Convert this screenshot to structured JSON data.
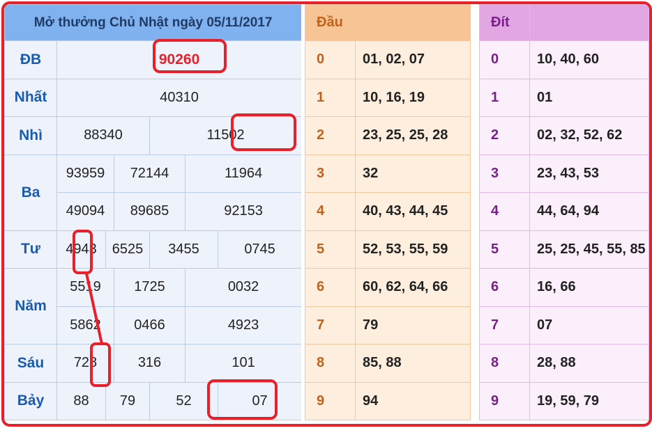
{
  "left_table": {
    "header": "Mở thưởng Chủ Nhật ngày 05/11/2017",
    "prizes": [
      {
        "label": "ĐB",
        "values": [
          "90260"
        ]
      },
      {
        "label": "Nhất",
        "values": [
          "40310"
        ]
      },
      {
        "label": "Nhì",
        "values": [
          "88340",
          "11502"
        ]
      },
      {
        "label": "Ba",
        "values": [
          "93959",
          "72144",
          "11964",
          "49094",
          "89685",
          "92153"
        ]
      },
      {
        "label": "Tư",
        "values": [
          "4943",
          "6525",
          "3455",
          "0745"
        ]
      },
      {
        "label": "Năm",
        "values": [
          "5519",
          "1725",
          "0032",
          "5862",
          "0466",
          "4923"
        ]
      },
      {
        "label": "Sáu",
        "values": [
          "728",
          "316",
          "101"
        ]
      },
      {
        "label": "Bảy",
        "values": [
          "88",
          "79",
          "52",
          "07"
        ]
      }
    ]
  },
  "dau_table": {
    "header": "Đầu",
    "rows": [
      {
        "key": "0",
        "values": "01, 02, 07"
      },
      {
        "key": "1",
        "values": "10, 16, 19"
      },
      {
        "key": "2",
        "values": "23, 25, 25, 28"
      },
      {
        "key": "3",
        "values": "32"
      },
      {
        "key": "4",
        "values": "40, 43, 44, 45"
      },
      {
        "key": "5",
        "values": "52, 53, 55, 59"
      },
      {
        "key": "6",
        "values": "60, 62, 64, 66"
      },
      {
        "key": "7",
        "values": "79"
      },
      {
        "key": "8",
        "values": "85, 88"
      },
      {
        "key": "9",
        "values": "94"
      }
    ]
  },
  "dit_table": {
    "header": "Đít",
    "rows": [
      {
        "key": "0",
        "values": "10, 40, 60"
      },
      {
        "key": "1",
        "values": "01"
      },
      {
        "key": "2",
        "values": "02, 32, 52, 62"
      },
      {
        "key": "3",
        "values": "23, 43, 53"
      },
      {
        "key": "4",
        "values": "44, 64, 94"
      },
      {
        "key": "5",
        "values": "25, 25, 45, 55, 85"
      },
      {
        "key": "6",
        "values": "16, 66"
      },
      {
        "key": "7",
        "values": "07"
      },
      {
        "key": "8",
        "values": "28, 88"
      },
      {
        "key": "9",
        "values": "19, 59, 79"
      }
    ]
  },
  "colors": {
    "annotation_red": "#e8202a",
    "left_header_bg": "#7fb2ef",
    "dau_header_bg": "#f6c495",
    "dit_header_bg": "#e2a6e2"
  }
}
